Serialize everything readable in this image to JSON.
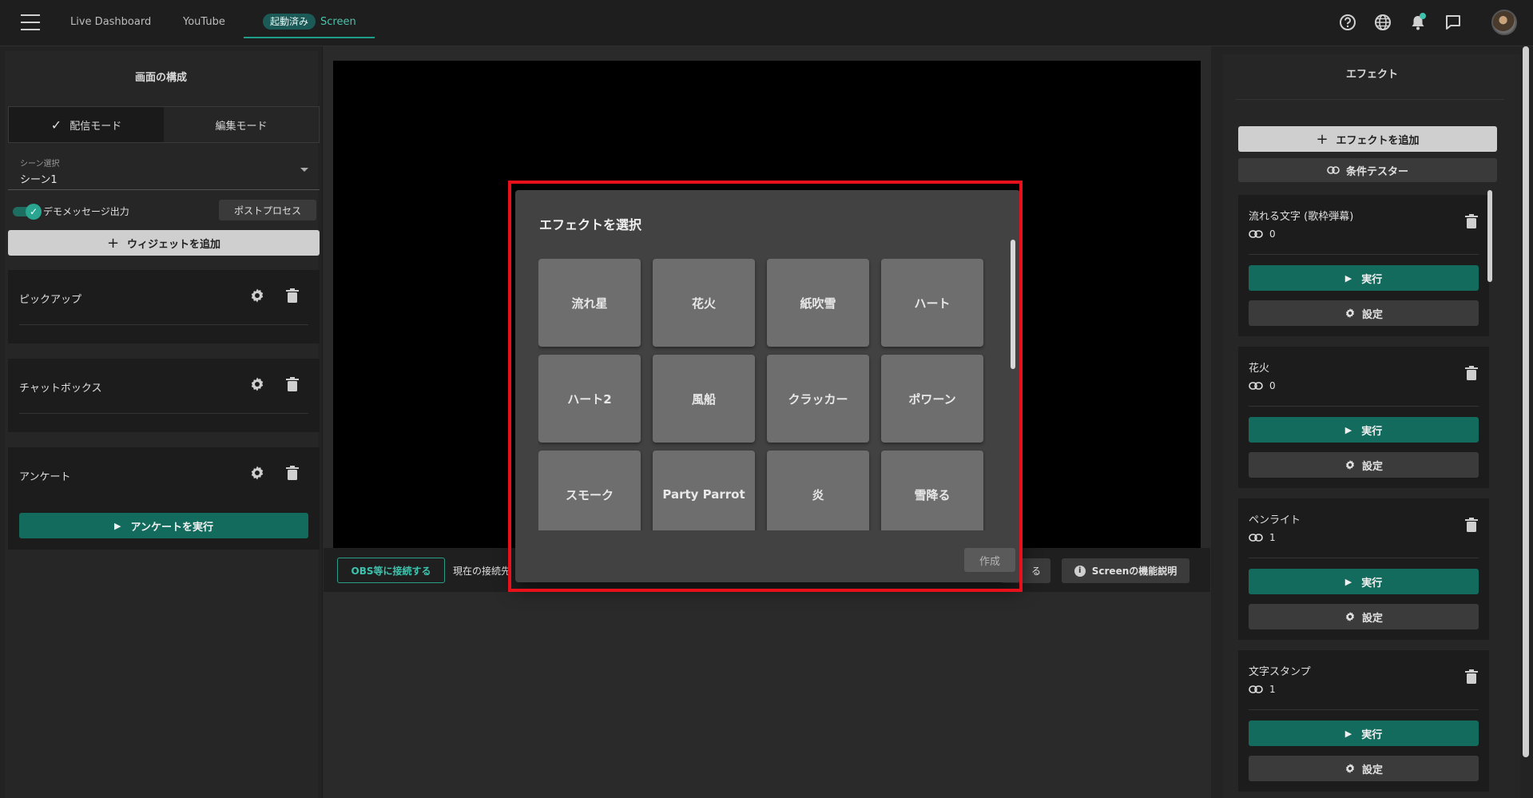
{
  "topbar": {
    "tabs": [
      {
        "label": "Live Dashboard"
      },
      {
        "label": "YouTube"
      },
      {
        "badge": "起動済み",
        "label": "Screen"
      }
    ]
  },
  "left": {
    "title": "画面の構成",
    "modes": {
      "broadcast": "配信モード",
      "edit": "編集モード"
    },
    "scene": {
      "label": "シーン選択",
      "value": "シーン1"
    },
    "demo_label": "デモメッセージ出力",
    "postprocess_label": "ポストプロセス",
    "add_widget_label": "ウィジェットを追加",
    "widgets": [
      {
        "name": "ピックアップ"
      },
      {
        "name": "チャットボックス"
      },
      {
        "name": "アンケート",
        "action": "アンケートを実行"
      }
    ]
  },
  "center": {
    "obs_button": "OBS等に接続する",
    "connection_text": "現在の接続先",
    "hidden_button": "る",
    "guide_button": "Screenの機能説明"
  },
  "right": {
    "title": "エフェクト",
    "add_effect_label": "エフェクトを追加",
    "condition_tester_label": "条件テスター",
    "effects": [
      {
        "name": "流れる文字 (歌枠弾幕)",
        "count": "0",
        "run": "実行",
        "settings": "設定"
      },
      {
        "name": "花火",
        "count": "0",
        "run": "実行",
        "settings": "設定"
      },
      {
        "name": "ペンライト",
        "count": "1",
        "run": "実行",
        "settings": "設定"
      },
      {
        "name": "文字スタンプ",
        "count": "1",
        "run": "実行",
        "settings": "設定"
      }
    ]
  },
  "modal": {
    "title": "エフェクトを選択",
    "tiles": [
      "流れ星",
      "花火",
      "紙吹雪",
      "ハート",
      "ハート2",
      "風船",
      "クラッカー",
      "ポワーン",
      "スモーク",
      "Party Parrot",
      "炎",
      "雪降る"
    ],
    "create_label": "作成"
  },
  "colors": {
    "accent": "#136b5e",
    "accent_text": "#3fc3ae",
    "highlight": "#e8101a"
  }
}
